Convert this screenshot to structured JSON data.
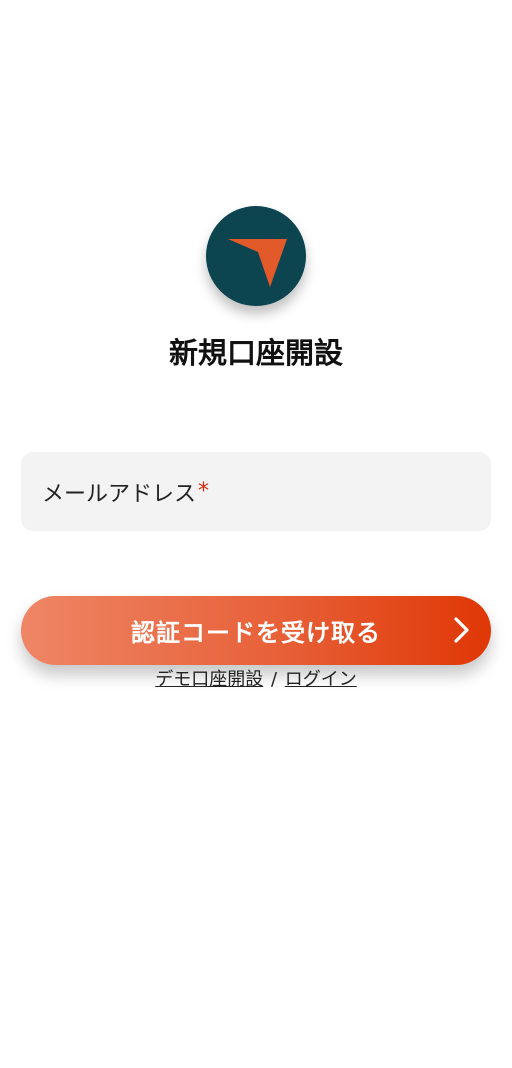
{
  "brand": {
    "logo_icon": "location-arrow-icon",
    "logo_bg": "#0c4450",
    "logo_fg": "#e25a2a"
  },
  "page": {
    "title": "新規口座開設"
  },
  "form": {
    "email_label": "メールアドレス",
    "required_mark": "*"
  },
  "submit": {
    "label": "認証コードを受け取る",
    "icon": "chevron-right-icon",
    "gradient": [
      "#ee8666",
      "#e03705"
    ]
  },
  "links": {
    "demo_label": "デモ口座開設",
    "separator": "/",
    "login_label": "ログイン"
  }
}
